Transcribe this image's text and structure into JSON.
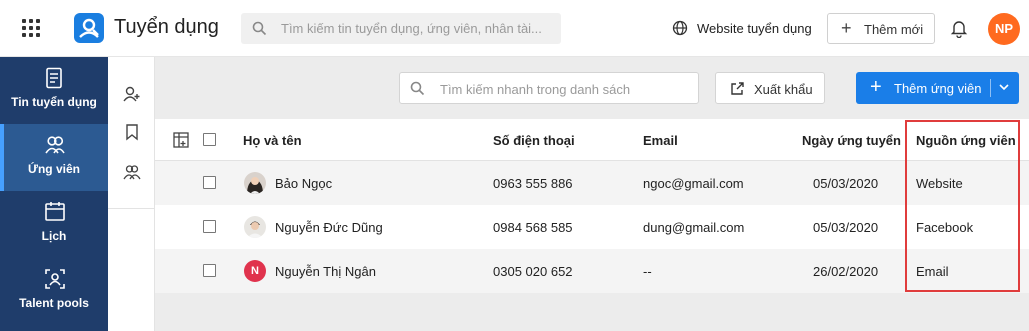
{
  "header": {
    "app_title": "Tuyển dụng",
    "search_placeholder": "Tìm kiếm tin tuyển dụng, ứng viên, nhân tài...",
    "website_link": "Website tuyển dụng",
    "new_button": "Thêm mới",
    "user_initials": "NP",
    "user_avatar_color": "#ff6a1f",
    "brand_color": "#1a7ee0"
  },
  "sidebar": {
    "items": [
      {
        "label": "Tin tuyển dụng",
        "icon": "job-post-icon",
        "active": false
      },
      {
        "label": "Ứng viên",
        "icon": "candidates-icon",
        "active": true
      },
      {
        "label": "Lịch",
        "icon": "calendar-icon",
        "active": false
      },
      {
        "label": "Talent pools",
        "icon": "talent-pool-icon",
        "active": false
      }
    ]
  },
  "subnav": {
    "icons": [
      "add-user-icon",
      "bookmark-icon",
      "group-icon"
    ]
  },
  "toolbar": {
    "search_placeholder": "Tìm kiếm nhanh trong danh sách",
    "export_label": "Xuất khẩu",
    "add_candidate_label": "Thêm ứng viên"
  },
  "table": {
    "columns": [
      "Họ và tên",
      "Số điện thoại",
      "Email",
      "Ngày ứng tuyển",
      "Nguồn ứng viên"
    ],
    "rows": [
      {
        "name": "Bảo Ngọc",
        "phone": "0963 555 886",
        "email": "ngoc@gmail.com",
        "date": "05/03/2020",
        "source": "Website",
        "avatar": "photo"
      },
      {
        "name": "Nguyễn Đức Dũng",
        "phone": "0984 568 585",
        "email": "dung@gmail.com",
        "date": "05/03/2020",
        "source": "Facebook",
        "avatar": "photo"
      },
      {
        "name": "Nguyễn Thị Ngân",
        "phone": "0305 020 652",
        "email": "--",
        "date": "26/02/2020",
        "source": "Email",
        "avatar": "N"
      }
    ]
  },
  "colors": {
    "nav_bg": "#1f3d6b",
    "nav_active": "#2c5a92",
    "primary_button": "#1a7ee8",
    "highlight_border": "#e03c3c"
  }
}
